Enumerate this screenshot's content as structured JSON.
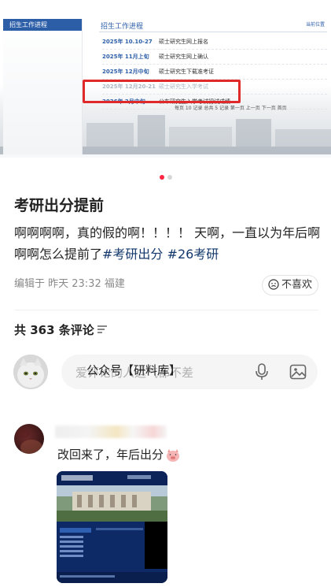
{
  "carousel": {
    "nav_header": "招生工作进程",
    "panel_title": "招生工作进程",
    "more_link": "当前位置",
    "rows": [
      {
        "date": "2025年 10.10-27",
        "event": "硕士研究生网上报名"
      },
      {
        "date": "2025年 11月上旬",
        "event": "硕士研究生网上确认"
      },
      {
        "date": "2025年 12月中旬",
        "event": "硕士研究生下载准考证"
      },
      {
        "date": "2025年 12月20-21",
        "event": "硕士研究生入学考试"
      },
      {
        "date": "2026年 2月中旬",
        "event": "公布研究生入学考试初试成绩"
      }
    ],
    "pager": "每页 10 记录   总共 5 记录   第一页  上一页  下一页   首页",
    "page_count": 2,
    "active_page": 1
  },
  "post": {
    "title": "考研出分提前",
    "body_text": "啊啊啊啊，真的假的啊！！！！ 天啊，一直以为年后啊啊啊怎么提前了",
    "tags": [
      "#考研出分",
      "#26考研"
    ],
    "edited": "编辑于  昨天 23:32 福建",
    "dislike_label": "不喜欢"
  },
  "comments": {
    "count_label": "共 363 条评论",
    "input_placeholder": "爱评论的人运气都不差",
    "input_overlay": "公众号【研料库】",
    "items": [
      {
        "text": "改回来了，年后出分"
      }
    ]
  },
  "colors": {
    "accent": "#ff2442",
    "tag": "#13386c",
    "site_blue": "#2c5ea8",
    "highlight_box": "#e02a2a"
  }
}
